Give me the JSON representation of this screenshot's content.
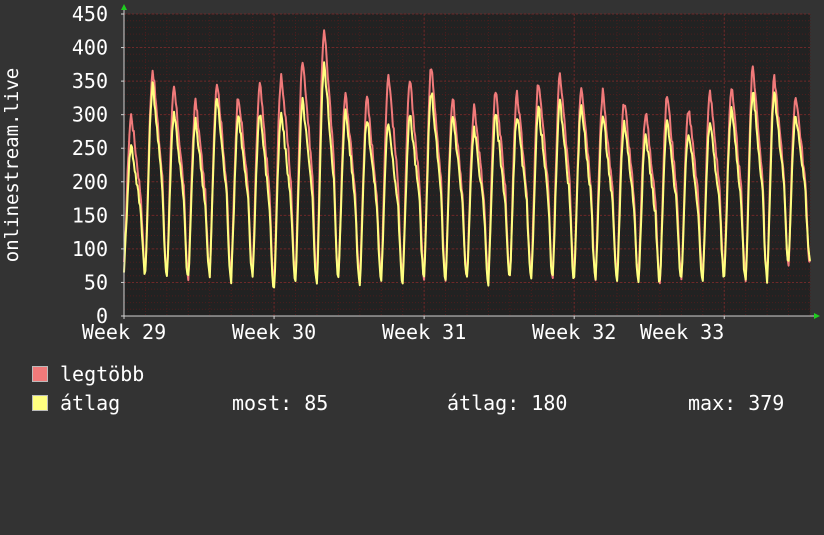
{
  "colors": {
    "background": "#333333",
    "plot_bg": "#222222",
    "grid": "#4a1e1e",
    "axis": "#d0d0d0",
    "text": "#ffffff",
    "max_series": "#f07a7a",
    "avg_series": "#ffff80",
    "arrow": "#1fcc1f"
  },
  "chart_data": {
    "type": "line",
    "ylabel": "onlinestream.live",
    "ylim": [
      0,
      450
    ],
    "yticks": [
      0,
      50,
      100,
      150,
      200,
      250,
      300,
      350,
      400,
      450
    ],
    "xlim": [
      0,
      32
    ],
    "xticks": [
      {
        "x": 0,
        "label": "Week 29"
      },
      {
        "x": 7,
        "label": "Week 30"
      },
      {
        "x": 14,
        "label": "Week 31"
      },
      {
        "x": 21,
        "label": "Week 32"
      },
      {
        "x": 28,
        "label": "Week 33"
      }
    ],
    "series": [
      {
        "name": "legtöbb",
        "color": "#f07a7a",
        "daily_peaks": [
          300,
          368,
          340,
          320,
          350,
          330,
          345,
          360,
          385,
          430,
          330,
          325,
          360,
          350,
          375,
          325,
          310,
          340,
          330,
          350,
          360,
          345,
          335,
          320,
          305,
          330,
          310,
          335,
          340,
          370,
          355,
          330
        ],
        "daily_lows": [
          75,
          70,
          65,
          60,
          65,
          60,
          65,
          45,
          60,
          55,
          60,
          55,
          60,
          55,
          60,
          55,
          60,
          58,
          60,
          58,
          60,
          60,
          60,
          58,
          60,
          55,
          60,
          60,
          60,
          58,
          60,
          80
        ]
      },
      {
        "name": "átlag",
        "color": "#ffff80",
        "daily_peaks": [
          255,
          345,
          305,
          290,
          325,
          300,
          305,
          300,
          320,
          375,
          305,
          295,
          290,
          300,
          335,
          300,
          280,
          300,
          300,
          310,
          320,
          315,
          300,
          290,
          270,
          290,
          275,
          290,
          310,
          335,
          330,
          300
        ],
        "daily_lows": [
          70,
          65,
          60,
          55,
          60,
          55,
          60,
          40,
          55,
          48,
          55,
          50,
          55,
          50,
          55,
          50,
          55,
          52,
          55,
          52,
          55,
          55,
          55,
          52,
          55,
          50,
          55,
          55,
          55,
          52,
          55,
          82
        ]
      }
    ]
  },
  "legend": {
    "items": [
      {
        "label": "legtöbb",
        "color": "#f07a7a"
      },
      {
        "label": "átlag",
        "color": "#ffff80"
      }
    ],
    "stats": {
      "most": "most: 85",
      "atlag": "átlag: 180",
      "max": "max: 379"
    }
  }
}
